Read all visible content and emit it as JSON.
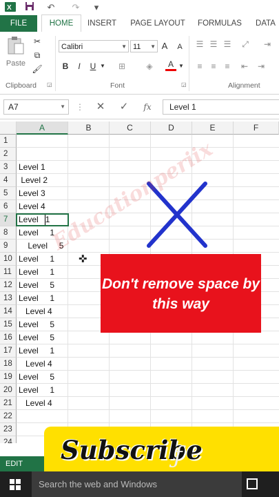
{
  "quick_access": {
    "undo": "↶",
    "redo": "↷"
  },
  "tabs": [
    {
      "label": "FILE"
    },
    {
      "label": "HOME"
    },
    {
      "label": "INSERT"
    },
    {
      "label": "PAGE LAYOUT"
    },
    {
      "label": "FORMULAS"
    },
    {
      "label": "DATA"
    }
  ],
  "ribbon": {
    "paste_label": "Paste",
    "clipboard_label": "Clipboard",
    "font_label": "Font",
    "alignment_label": "Alignment",
    "font_name": "Calibri",
    "font_size": "11",
    "bold": "B",
    "italic": "I",
    "underline": "U",
    "grow": "A",
    "shrink": "A",
    "font_color": "A"
  },
  "formula_bar": {
    "name_box": "A7",
    "fx": "fx",
    "value": "Level  1"
  },
  "columns": [
    "A",
    "B",
    "C",
    "D",
    "E",
    "F"
  ],
  "rows": [
    "1",
    "2",
    "3",
    "4",
    "5",
    "6",
    "7",
    "8",
    "9",
    "10",
    "11",
    "12",
    "13",
    "14",
    "15",
    "16",
    "17",
    "18",
    "19",
    "20",
    "21",
    "22",
    "23",
    "24"
  ],
  "cells": [
    {
      "row": 3,
      "text": "Level 1"
    },
    {
      "row": 4,
      "text": " Level 2"
    },
    {
      "row": 5,
      "text": "Level 3"
    },
    {
      "row": 6,
      "text": "Level 4"
    },
    {
      "row": 7,
      "text": "Level   1"
    },
    {
      "row": 8,
      "text": "Level     1"
    },
    {
      "row": 9,
      "text": "    Level     5"
    },
    {
      "row": 10,
      "text": "Level     1"
    },
    {
      "row": 11,
      "text": "Level     1"
    },
    {
      "row": 12,
      "text": "Level     5"
    },
    {
      "row": 13,
      "text": "Level     1"
    },
    {
      "row": 14,
      "text": "   Level 4"
    },
    {
      "row": 15,
      "text": "Level     5"
    },
    {
      "row": 16,
      "text": "Level     5"
    },
    {
      "row": 17,
      "text": "Level     1"
    },
    {
      "row": 18,
      "text": "   Level 4"
    },
    {
      "row": 19,
      "text": "Level     5"
    },
    {
      "row": 20,
      "text": "Level     1"
    },
    {
      "row": 21,
      "text": "   Level 4"
    }
  ],
  "overlay": {
    "warning_text": "Don't remove space by this way",
    "watermark": "Educationperiix",
    "subscribe": "Subscribe"
  },
  "status": "EDIT",
  "taskbar": {
    "search_placeholder": "Search the web and Windows"
  },
  "colors": {
    "excel_green": "#217346",
    "red_box": "#e8121c",
    "cross_blue": "#2233cc",
    "subscribe_yellow": "#ffe000"
  }
}
